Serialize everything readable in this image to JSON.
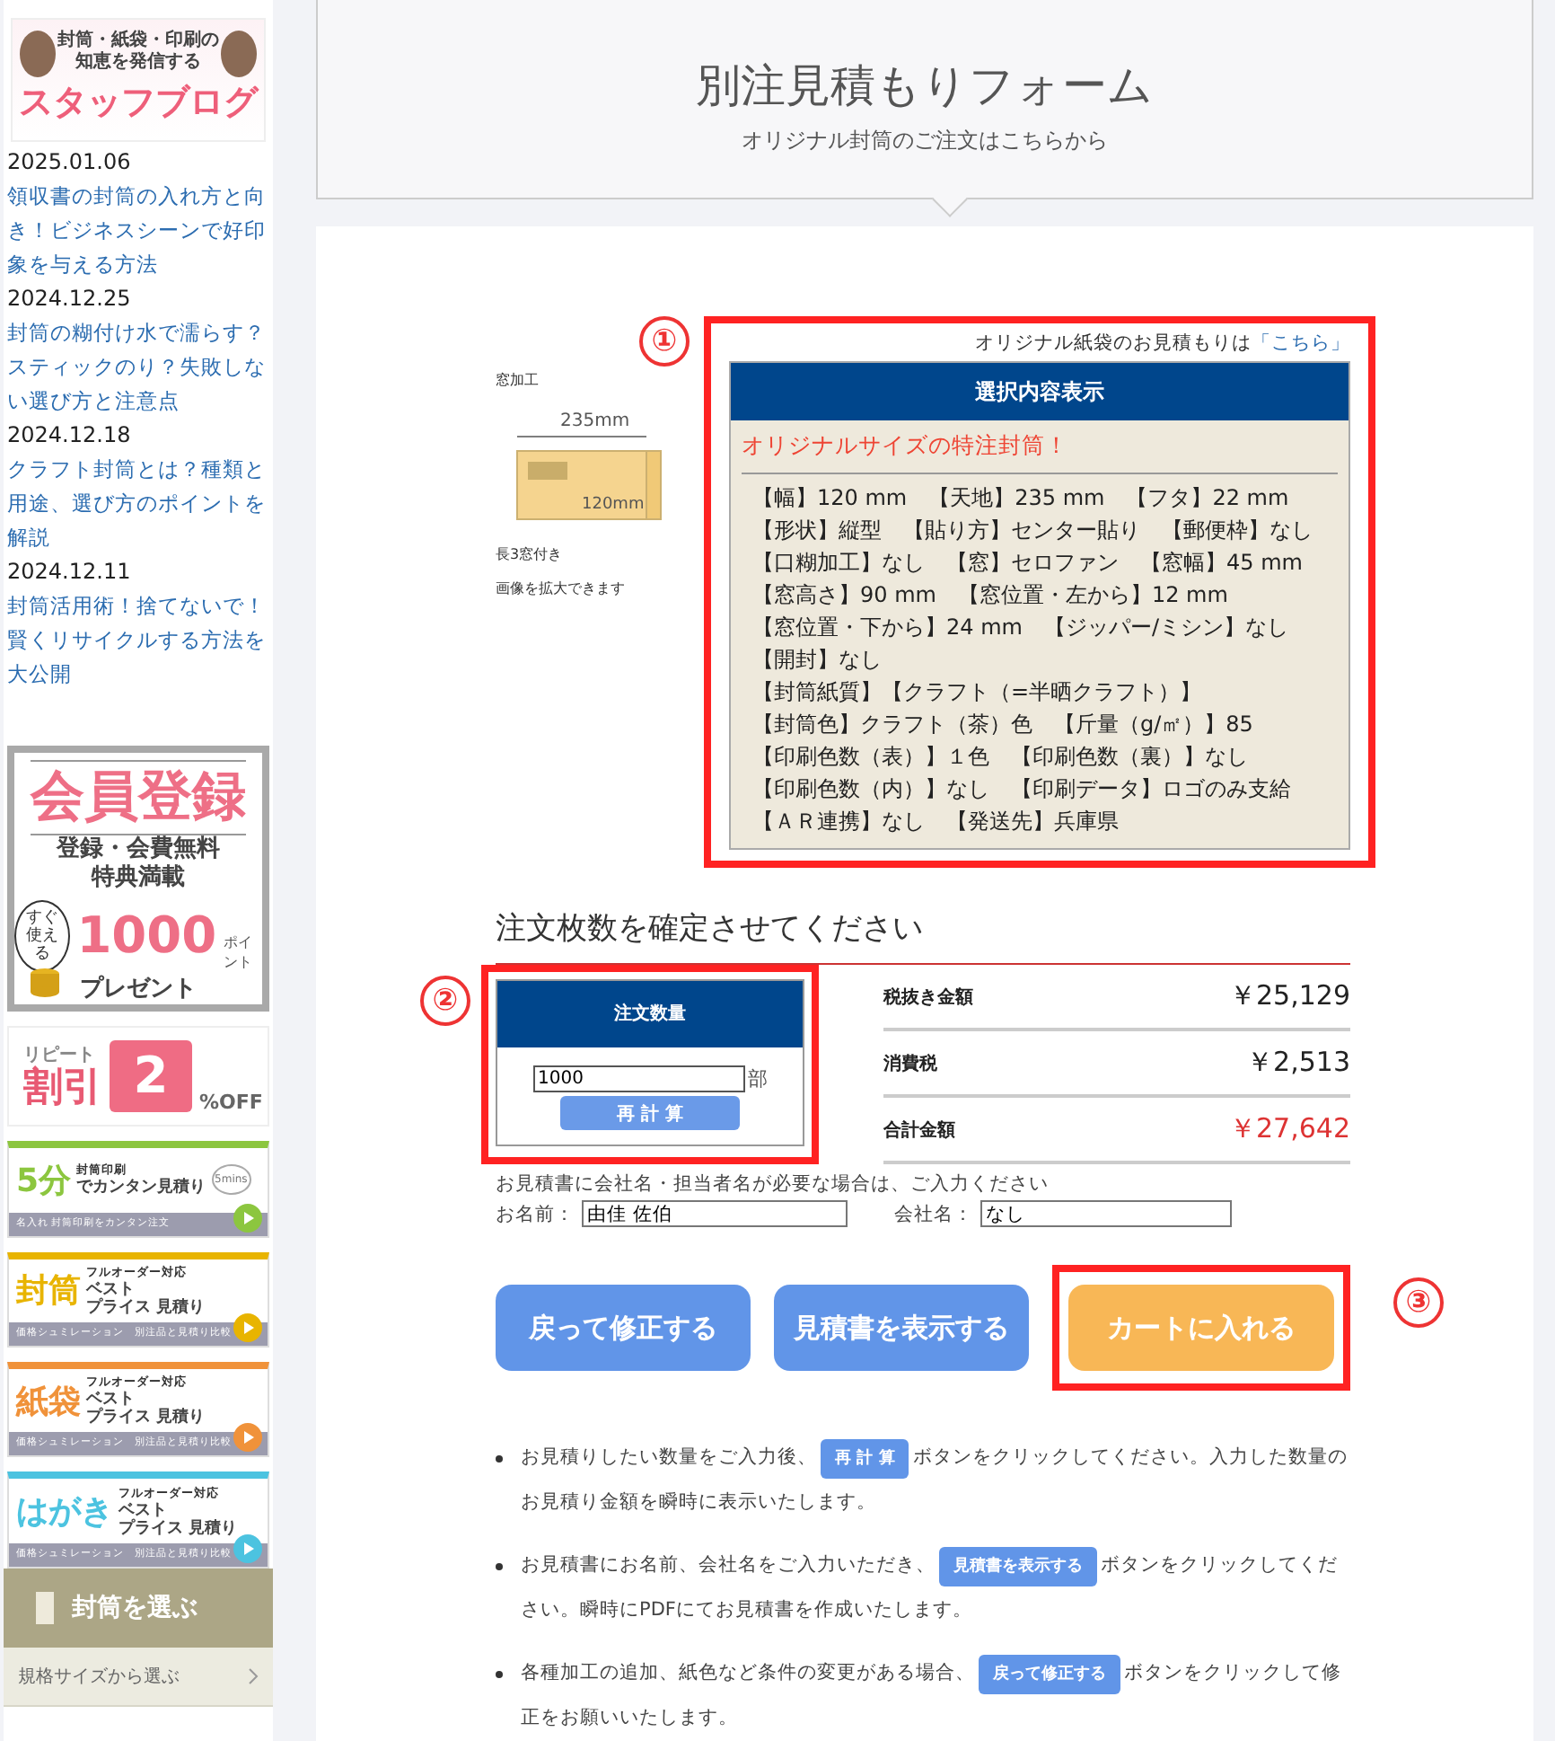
{
  "sidebar": {
    "blog_banner": {
      "line1": "封筒・紙袋・印刷の",
      "line2": "知恵を発信する",
      "title": "スタッフブログ"
    },
    "posts": [
      {
        "date": "2025.01.06",
        "title": "領収書の封筒の入れ方と向き！ビジネスシーンで好印象を与える方法"
      },
      {
        "date": "2024.12.25",
        "title": "封筒の糊付け水で濡らす？スティックのり？失敗しない選び方と注意点"
      },
      {
        "date": "2024.12.18",
        "title": "クラフト封筒とは？種類と用途、選び方のポイントを解説"
      },
      {
        "date": "2024.12.11",
        "title": "封筒活用術！捨てないで！賢くリサイクルする方法を大公開"
      }
    ],
    "member_banner": {
      "title": "会員登録",
      "line1": "登録・会費無料",
      "line2": "特典満載",
      "bubble": "すぐ使える",
      "points": "1000",
      "points_unit": "ポイント",
      "present": "プレゼント"
    },
    "repeat_banner": {
      "line1": "リピート",
      "line2": "割引",
      "number": "2",
      "unit": "%OFF"
    },
    "estimate_banners": [
      {
        "kind": "quick",
        "big": "5分",
        "tag": "封筒印刷",
        "main": "でカンタン見積り",
        "badge": "5mins",
        "footer": "名入れ 封筒印刷をカンタン注文",
        "color": "#8cc63f"
      },
      {
        "kind": "best",
        "big": "封筒",
        "tag": "フルオーダー対応",
        "sub1": "ベスト",
        "sub2": "プライス 見積り",
        "footer": "価格シュミレーション　別注品と見積り比較",
        "color": "#e8b400"
      },
      {
        "kind": "best",
        "big": "紙袋",
        "tag": "フルオーダー対応",
        "sub1": "ベスト",
        "sub2": "プライス 見積り",
        "footer": "価格シュミレーション　別注品と見積り比較",
        "color": "#f0923a"
      },
      {
        "kind": "best",
        "big": "はがき",
        "tag": "フルオーダー対応",
        "sub1": "ベスト",
        "sub2": "プライス 見積り",
        "footer": "価格シュミレーション　別注品と見積り比較",
        "color": "#4cc3e0"
      }
    ],
    "menu": {
      "title": "封筒を選ぶ",
      "items": [
        "規格サイズから選ぶ"
      ]
    }
  },
  "header": {
    "title": "別注見積もりフォーム",
    "subtitle": "オリジナル封筒のご注文はこちらから"
  },
  "markers": [
    "①",
    "②",
    "③"
  ],
  "image": {
    "label": "窓加工",
    "width": "235mm",
    "height": "120mm",
    "caption": "長3窓付き",
    "hint": "画像を拡大できます"
  },
  "selection": {
    "note": "オリジナル紙袋のお見積もりは",
    "link": "「こちら」",
    "title": "選択内容表示",
    "headline": "オリジナルサイズの特注封筒！",
    "lines": [
      "【幅】120 mm　【天地】235 mm　【フタ】22 mm",
      "【形状】縦型　【貼り方】センター貼り　【郵便枠】なし",
      "【口糊加工】なし　【窓】セロファン　【窓幅】45 mm",
      "【窓高さ】90 mm　【窓位置・左から】12 mm",
      "【窓位置・下から】24 mm　【ジッパー/ミシン】なし",
      "【開封】なし",
      "【封筒紙質】【クラフト（=半晒クラフト）】",
      "【封筒色】クラフト（茶）色　【斤量（g/㎡）】85",
      "【印刷色数（表）】１色　【印刷色数（裏）】なし",
      "【印刷色数（内）】なし　【印刷データ】ロゴのみ支給",
      "【ＡＲ連携】なし　【発送先】兵庫県"
    ]
  },
  "order": {
    "heading": "注文枚数を確定させてください",
    "quantity_title": "注文数量",
    "quantity": "1000",
    "unit": "部",
    "recalc": "再 計 算",
    "prices": [
      {
        "label": "税抜き金額",
        "value": "￥25,129",
        "kind": "normal"
      },
      {
        "label": "消費税",
        "value": "￥2,513",
        "kind": "normal"
      },
      {
        "label": "合計金額",
        "value": "￥27,642",
        "kind": "total"
      }
    ],
    "note": "お見積書に会社名・担当者名が必要な場合は、ご入力ください",
    "name_label": "お名前：",
    "name": "由佳 佐伯",
    "company_label": "会社名：",
    "company": "なし"
  },
  "buttons": [
    {
      "label": "戻って修正する",
      "kind": "blue"
    },
    {
      "label": "見積書を表示する",
      "kind": "blue"
    },
    {
      "label": "カートに入れる",
      "kind": "orange"
    }
  ],
  "instructions": [
    {
      "before": "お見積りしたい数量をご入力後、",
      "button": "再 計 算",
      "after": "ボタンをクリックしてください。入力した数量のお見積り金額を瞬時に表示いたします。"
    },
    {
      "before": "お見積書にお名前、会社名をご入力いただき、",
      "button": "見積書を表示する",
      "after": "ボタンをクリックしてください。瞬時にPDFにてお見積書を作成いたします。"
    },
    {
      "before": "各種加工の追加、紙色など条件の変更がある場合、",
      "button": "戻って修正する",
      "after": "ボタンをクリックして修正をお願いいたします。"
    }
  ]
}
